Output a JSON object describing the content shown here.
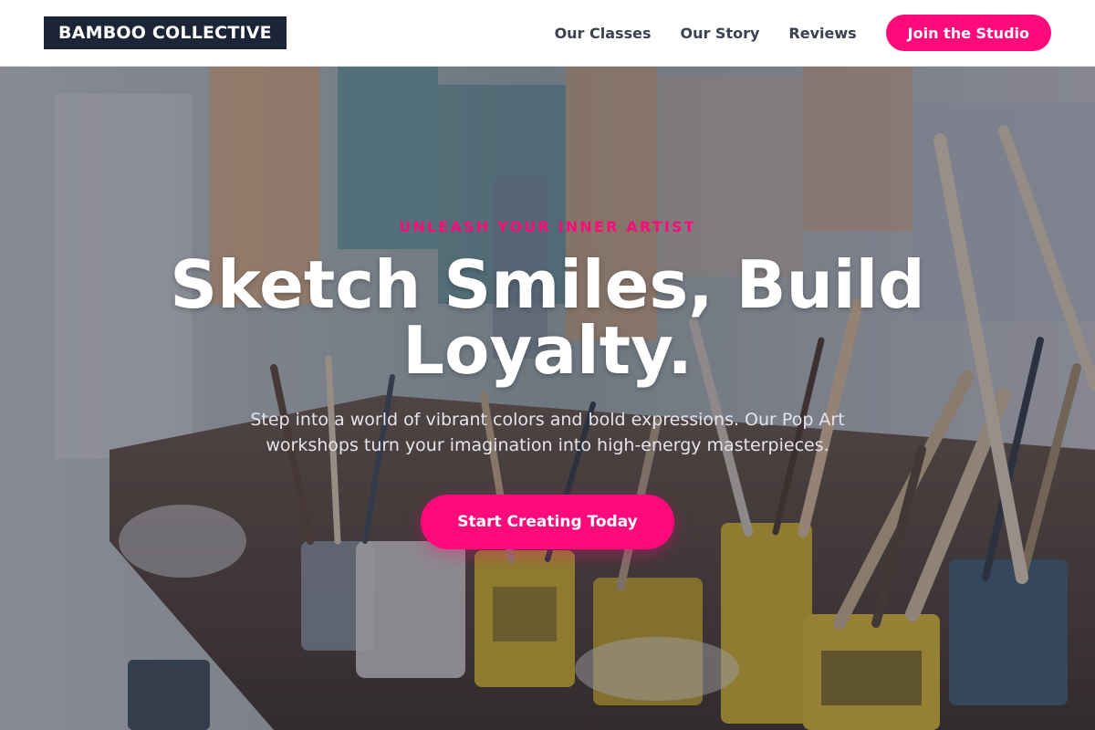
{
  "brand": {
    "logo_text": "BAMBOO COLLECTIVE"
  },
  "nav": {
    "links": [
      "Our Classes",
      "Our Story",
      "Reviews"
    ],
    "cta_label": "Join the Studio"
  },
  "hero": {
    "eyebrow": "UNLEASH YOUR INNER ARTIST",
    "headline": "Sketch Smiles, Build Loyalty.",
    "subtext": "Step into a world of vibrant colors and bold expressions. Our Pop Art workshops turn your imagination into high-energy masterpieces.",
    "cta_label": "Start Creating Today",
    "background_image": "art-studio-paint-brushes-photo"
  },
  "colors": {
    "accent": "#ff0a7a",
    "logo_bg": "#1c2538",
    "nav_text": "#3b4151"
  }
}
